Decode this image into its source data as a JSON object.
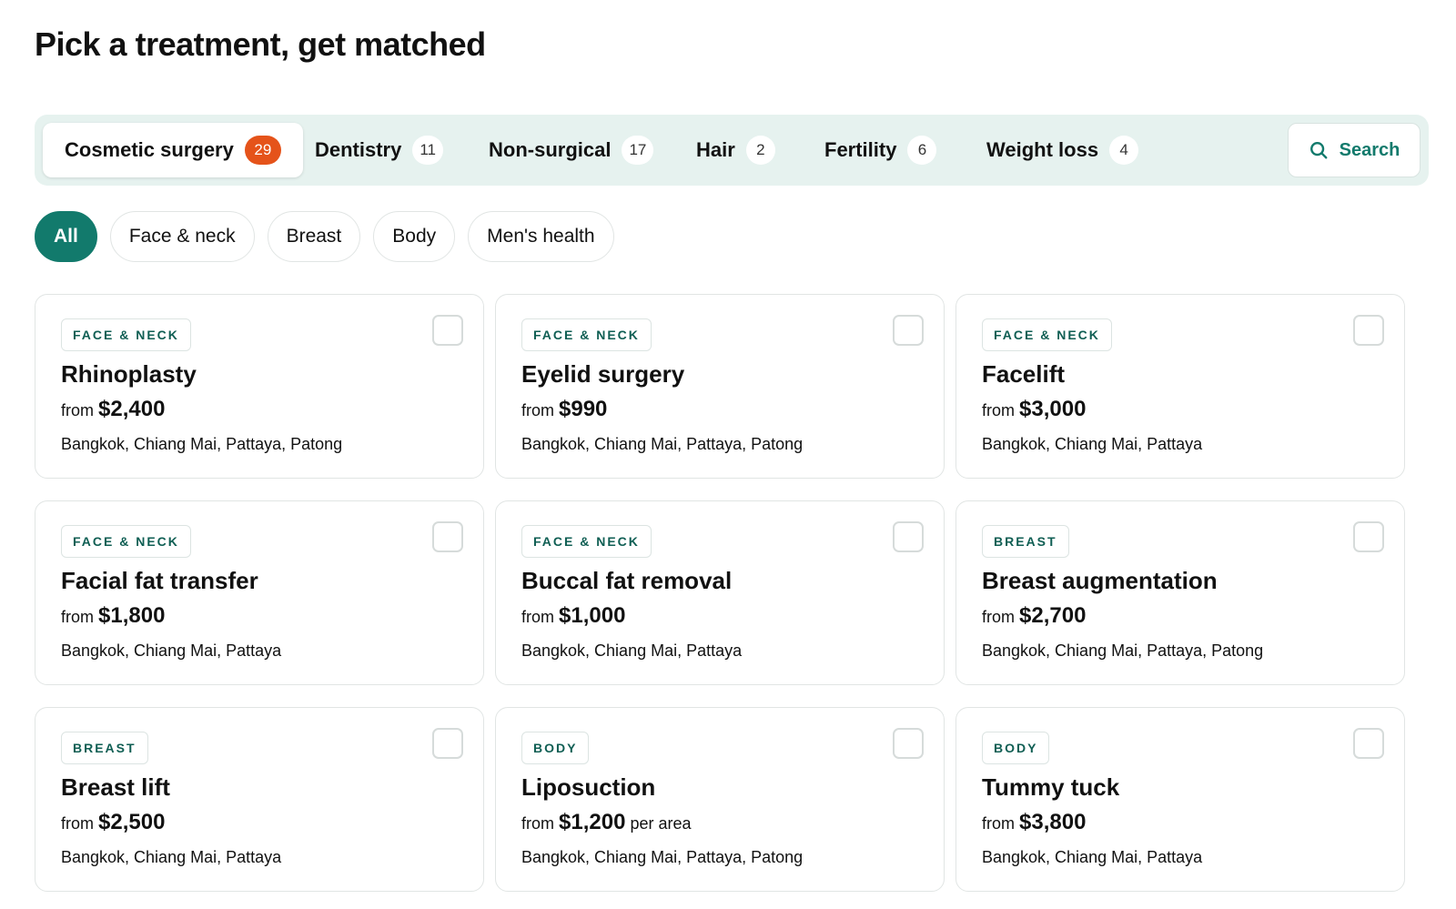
{
  "page": {
    "title": "Pick a treatment, get matched"
  },
  "colors": {
    "accent": "#127a6c",
    "badge_active": "#e5531a",
    "tab_bar_bg": "#e6f2ef",
    "tag_text": "#0f5e53"
  },
  "tabs": [
    {
      "label": "Cosmetic surgery",
      "count": "29",
      "active": true
    },
    {
      "label": "Dentistry",
      "count": "11",
      "active": false
    },
    {
      "label": "Non-surgical",
      "count": "17",
      "active": false
    },
    {
      "label": "Hair",
      "count": "2",
      "active": false
    },
    {
      "label": "Fertility",
      "count": "6",
      "active": false
    },
    {
      "label": "Weight loss",
      "count": "4",
      "active": false
    }
  ],
  "search": {
    "label": "Search",
    "icon": "search-icon"
  },
  "filters": [
    {
      "label": "All",
      "active": true
    },
    {
      "label": "Face & neck",
      "active": false
    },
    {
      "label": "Breast",
      "active": false
    },
    {
      "label": "Body",
      "active": false
    },
    {
      "label": "Men's health",
      "active": false
    }
  ],
  "cards": [
    {
      "tag": "FACE & NECK",
      "name": "Rhinoplasty",
      "from": "from",
      "price": "$2,400",
      "suffix": "",
      "locations": "Bangkok, Chiang Mai, Pattaya, Patong",
      "checked": false
    },
    {
      "tag": "FACE & NECK",
      "name": "Eyelid surgery",
      "from": "from",
      "price": "$990",
      "suffix": "",
      "locations": "Bangkok, Chiang Mai, Pattaya, Patong",
      "checked": false
    },
    {
      "tag": "FACE & NECK",
      "name": "Facelift",
      "from": "from",
      "price": "$3,000",
      "suffix": "",
      "locations": "Bangkok, Chiang Mai, Pattaya",
      "checked": false
    },
    {
      "tag": "FACE & NECK",
      "name": "Facial fat transfer",
      "from": "from",
      "price": "$1,800",
      "suffix": "",
      "locations": "Bangkok, Chiang Mai, Pattaya",
      "checked": false
    },
    {
      "tag": "FACE & NECK",
      "name": "Buccal fat removal",
      "from": "from",
      "price": "$1,000",
      "suffix": "",
      "locations": "Bangkok, Chiang Mai, Pattaya",
      "checked": false
    },
    {
      "tag": "BREAST",
      "name": "Breast augmentation",
      "from": "from",
      "price": "$2,700",
      "suffix": "",
      "locations": "Bangkok, Chiang Mai, Pattaya, Patong",
      "checked": false
    },
    {
      "tag": "BREAST",
      "name": "Breast lift",
      "from": "from",
      "price": "$2,500",
      "suffix": "",
      "locations": "Bangkok, Chiang Mai, Pattaya",
      "checked": false
    },
    {
      "tag": "BODY",
      "name": "Liposuction",
      "from": "from",
      "price": "$1,200",
      "suffix": "per area",
      "locations": "Bangkok, Chiang Mai, Pattaya, Patong",
      "checked": false
    },
    {
      "tag": "BODY",
      "name": "Tummy tuck",
      "from": "from",
      "price": "$3,800",
      "suffix": "",
      "locations": "Bangkok, Chiang Mai, Pattaya",
      "checked": false
    }
  ]
}
